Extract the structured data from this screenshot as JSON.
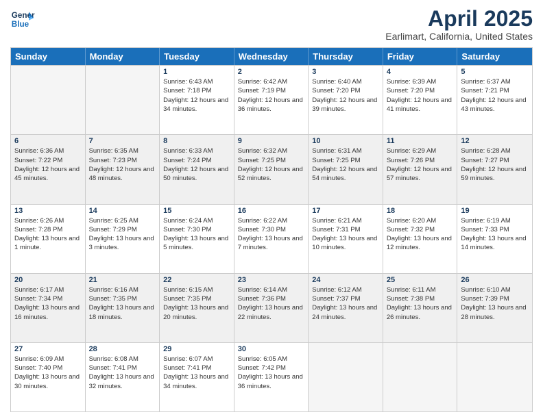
{
  "header": {
    "logo_line1": "General",
    "logo_line2": "Blue",
    "title": "April 2025",
    "subtitle": "Earlimart, California, United States"
  },
  "weekdays": [
    "Sunday",
    "Monday",
    "Tuesday",
    "Wednesday",
    "Thursday",
    "Friday",
    "Saturday"
  ],
  "rows": [
    [
      {
        "day": "",
        "text": "",
        "empty": true
      },
      {
        "day": "",
        "text": "",
        "empty": true
      },
      {
        "day": "1",
        "text": "Sunrise: 6:43 AM\nSunset: 7:18 PM\nDaylight: 12 hours and 34 minutes."
      },
      {
        "day": "2",
        "text": "Sunrise: 6:42 AM\nSunset: 7:19 PM\nDaylight: 12 hours and 36 minutes."
      },
      {
        "day": "3",
        "text": "Sunrise: 6:40 AM\nSunset: 7:20 PM\nDaylight: 12 hours and 39 minutes."
      },
      {
        "day": "4",
        "text": "Sunrise: 6:39 AM\nSunset: 7:20 PM\nDaylight: 12 hours and 41 minutes."
      },
      {
        "day": "5",
        "text": "Sunrise: 6:37 AM\nSunset: 7:21 PM\nDaylight: 12 hours and 43 minutes."
      }
    ],
    [
      {
        "day": "6",
        "text": "Sunrise: 6:36 AM\nSunset: 7:22 PM\nDaylight: 12 hours and 45 minutes.",
        "shaded": true
      },
      {
        "day": "7",
        "text": "Sunrise: 6:35 AM\nSunset: 7:23 PM\nDaylight: 12 hours and 48 minutes.",
        "shaded": true
      },
      {
        "day": "8",
        "text": "Sunrise: 6:33 AM\nSunset: 7:24 PM\nDaylight: 12 hours and 50 minutes.",
        "shaded": true
      },
      {
        "day": "9",
        "text": "Sunrise: 6:32 AM\nSunset: 7:25 PM\nDaylight: 12 hours and 52 minutes.",
        "shaded": true
      },
      {
        "day": "10",
        "text": "Sunrise: 6:31 AM\nSunset: 7:25 PM\nDaylight: 12 hours and 54 minutes.",
        "shaded": true
      },
      {
        "day": "11",
        "text": "Sunrise: 6:29 AM\nSunset: 7:26 PM\nDaylight: 12 hours and 57 minutes.",
        "shaded": true
      },
      {
        "day": "12",
        "text": "Sunrise: 6:28 AM\nSunset: 7:27 PM\nDaylight: 12 hours and 59 minutes.",
        "shaded": true
      }
    ],
    [
      {
        "day": "13",
        "text": "Sunrise: 6:26 AM\nSunset: 7:28 PM\nDaylight: 13 hours and 1 minute."
      },
      {
        "day": "14",
        "text": "Sunrise: 6:25 AM\nSunset: 7:29 PM\nDaylight: 13 hours and 3 minutes."
      },
      {
        "day": "15",
        "text": "Sunrise: 6:24 AM\nSunset: 7:30 PM\nDaylight: 13 hours and 5 minutes."
      },
      {
        "day": "16",
        "text": "Sunrise: 6:22 AM\nSunset: 7:30 PM\nDaylight: 13 hours and 7 minutes."
      },
      {
        "day": "17",
        "text": "Sunrise: 6:21 AM\nSunset: 7:31 PM\nDaylight: 13 hours and 10 minutes."
      },
      {
        "day": "18",
        "text": "Sunrise: 6:20 AM\nSunset: 7:32 PM\nDaylight: 13 hours and 12 minutes."
      },
      {
        "day": "19",
        "text": "Sunrise: 6:19 AM\nSunset: 7:33 PM\nDaylight: 13 hours and 14 minutes."
      }
    ],
    [
      {
        "day": "20",
        "text": "Sunrise: 6:17 AM\nSunset: 7:34 PM\nDaylight: 13 hours and 16 minutes.",
        "shaded": true
      },
      {
        "day": "21",
        "text": "Sunrise: 6:16 AM\nSunset: 7:35 PM\nDaylight: 13 hours and 18 minutes.",
        "shaded": true
      },
      {
        "day": "22",
        "text": "Sunrise: 6:15 AM\nSunset: 7:35 PM\nDaylight: 13 hours and 20 minutes.",
        "shaded": true
      },
      {
        "day": "23",
        "text": "Sunrise: 6:14 AM\nSunset: 7:36 PM\nDaylight: 13 hours and 22 minutes.",
        "shaded": true
      },
      {
        "day": "24",
        "text": "Sunrise: 6:12 AM\nSunset: 7:37 PM\nDaylight: 13 hours and 24 minutes.",
        "shaded": true
      },
      {
        "day": "25",
        "text": "Sunrise: 6:11 AM\nSunset: 7:38 PM\nDaylight: 13 hours and 26 minutes.",
        "shaded": true
      },
      {
        "day": "26",
        "text": "Sunrise: 6:10 AM\nSunset: 7:39 PM\nDaylight: 13 hours and 28 minutes.",
        "shaded": true
      }
    ],
    [
      {
        "day": "27",
        "text": "Sunrise: 6:09 AM\nSunset: 7:40 PM\nDaylight: 13 hours and 30 minutes."
      },
      {
        "day": "28",
        "text": "Sunrise: 6:08 AM\nSunset: 7:41 PM\nDaylight: 13 hours and 32 minutes."
      },
      {
        "day": "29",
        "text": "Sunrise: 6:07 AM\nSunset: 7:41 PM\nDaylight: 13 hours and 34 minutes."
      },
      {
        "day": "30",
        "text": "Sunrise: 6:05 AM\nSunset: 7:42 PM\nDaylight: 13 hours and 36 minutes."
      },
      {
        "day": "",
        "text": "",
        "empty": true
      },
      {
        "day": "",
        "text": "",
        "empty": true
      },
      {
        "day": "",
        "text": "",
        "empty": true
      }
    ]
  ]
}
